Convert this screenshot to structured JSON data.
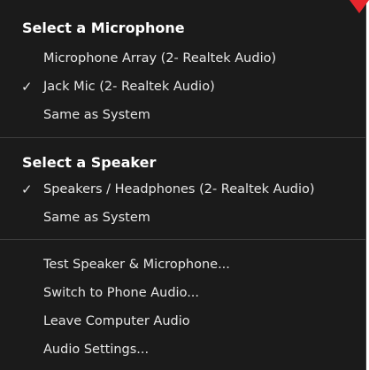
{
  "microphone": {
    "header": "Select a Microphone",
    "items": [
      {
        "label": "Microphone Array (2- Realtek Audio)",
        "selected": false
      },
      {
        "label": "Jack Mic (2- Realtek Audio)",
        "selected": true
      },
      {
        "label": "Same as System",
        "selected": false
      }
    ]
  },
  "speaker": {
    "header": "Select a Speaker",
    "items": [
      {
        "label": "Speakers / Headphones (2- Realtek Audio)",
        "selected": true
      },
      {
        "label": "Same as System",
        "selected": false
      }
    ]
  },
  "actions": {
    "items": [
      {
        "label": "Test Speaker & Microphone..."
      },
      {
        "label": "Switch to Phone Audio..."
      },
      {
        "label": "Leave Computer Audio"
      },
      {
        "label": "Audio Settings..."
      }
    ]
  },
  "check_glyph": "✓",
  "colors": {
    "menu_background": "#1b1b1b",
    "text": "#e6e6e6",
    "header_text": "#ffffff",
    "divider": "#3e3e3e",
    "corner_marker": "#e8262d"
  }
}
